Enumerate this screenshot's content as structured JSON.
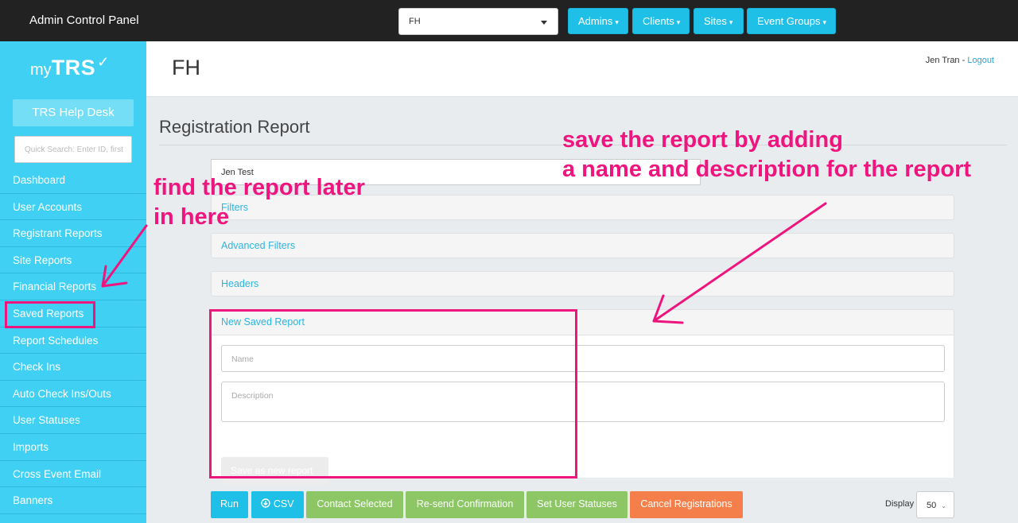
{
  "topbar": {
    "brand": "Admin Control Panel",
    "client_select_value": "FH",
    "nav": [
      {
        "label": "Admins",
        "caret": "▾"
      },
      {
        "label": "Clients",
        "caret": "▾"
      },
      {
        "label": "Sites",
        "caret": "▾"
      },
      {
        "label": "Event Groups",
        "caret": "▾"
      }
    ]
  },
  "sidebar": {
    "logo_my": "my",
    "logo_trs": "TRS",
    "logo_check": "✓",
    "help_desk": "TRS Help Desk",
    "quick_search_placeholder": "Quick Search: Enter ID, first",
    "items": [
      {
        "label": "Dashboard"
      },
      {
        "label": "User Accounts"
      },
      {
        "label": "Registrant Reports"
      },
      {
        "label": "Site Reports"
      },
      {
        "label": "Financial Reports"
      },
      {
        "label": "Saved Reports"
      },
      {
        "label": "Report Schedules"
      },
      {
        "label": "Check Ins"
      },
      {
        "label": "Auto Check Ins/Outs"
      },
      {
        "label": "User Statuses"
      },
      {
        "label": "Imports"
      },
      {
        "label": "Cross Event Email"
      },
      {
        "label": "Banners"
      }
    ]
  },
  "header": {
    "title": "FH",
    "user_name": "Jen Tran",
    "separator": " - ",
    "logout": "Logout"
  },
  "main": {
    "page_title": "Registration Report",
    "report_select_value": "Jen Test",
    "panels": {
      "filters": "Filters",
      "advanced_filters": "Advanced Filters",
      "headers": "Headers",
      "new_saved_report": "New Saved Report"
    },
    "name_placeholder": "Name",
    "description_placeholder": "Description",
    "save_button": "Save as new report"
  },
  "toolbar": {
    "run": "Run",
    "csv": "CSV",
    "contact_selected": "Contact Selected",
    "resend_confirmation": "Re-send Confirmation",
    "set_user_statuses": "Set User Statuses",
    "cancel_registrations": "Cancel Registrations",
    "display_label": "Display",
    "display_value": "50",
    "display_caret": "⌄"
  },
  "annotations": {
    "left_line1": "find the report later",
    "left_line2": "in here",
    "right_line1": "save the report by adding",
    "right_line2": "a name and description for the report"
  },
  "colors": {
    "accent": "#1ec0e8",
    "sidebar": "#3fd0f4",
    "green": "#8cc665",
    "orange": "#f47f4a",
    "annotation": "#ef157e"
  }
}
